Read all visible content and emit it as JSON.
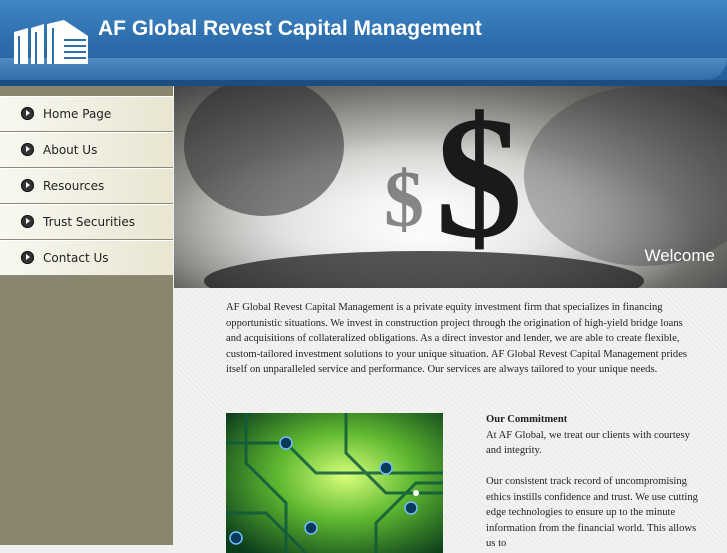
{
  "header": {
    "title": "AF Global Revest Capital Management",
    "logo_icon": "building-icon"
  },
  "nav": {
    "items": [
      {
        "label": "Home Page",
        "icon": "arrow-bullet-icon"
      },
      {
        "label": "About Us",
        "icon": "arrow-bullet-icon"
      },
      {
        "label": "Resources",
        "icon": "arrow-bullet-icon"
      },
      {
        "label": "Trust Securities",
        "icon": "arrow-bullet-icon"
      },
      {
        "label": "Contact Us",
        "icon": "arrow-bullet-icon"
      }
    ]
  },
  "hero": {
    "caption": "Welcome",
    "symbol": "$"
  },
  "main": {
    "intro": "AF Global Revest Capital Management is a private equity investment firm that specializes in financing opportunistic situations. We invest in construction project through the origination of high-yield bridge loans and acquisitions of collateralized obligations. As a direct investor and lender, we are able to create flexible, custom-tailored investment solutions to your unique situation.  AF Global Revest Capital Management prides itself on unparalleled service and performance.  Our services are always tailored to your unique needs.",
    "commitment_title": "Our Commitment",
    "commitment_p1": "At AF Global, we treat our clients with courtesy and integrity.",
    "commitment_p2": "Our consistent track record of uncompromising ethics instills confidence and trust. We use cutting edge technologies to ensure up to the minute information from the financial world. This allows us to"
  },
  "colors": {
    "header": "#2e6fae",
    "sidebar": "#8a856f"
  }
}
